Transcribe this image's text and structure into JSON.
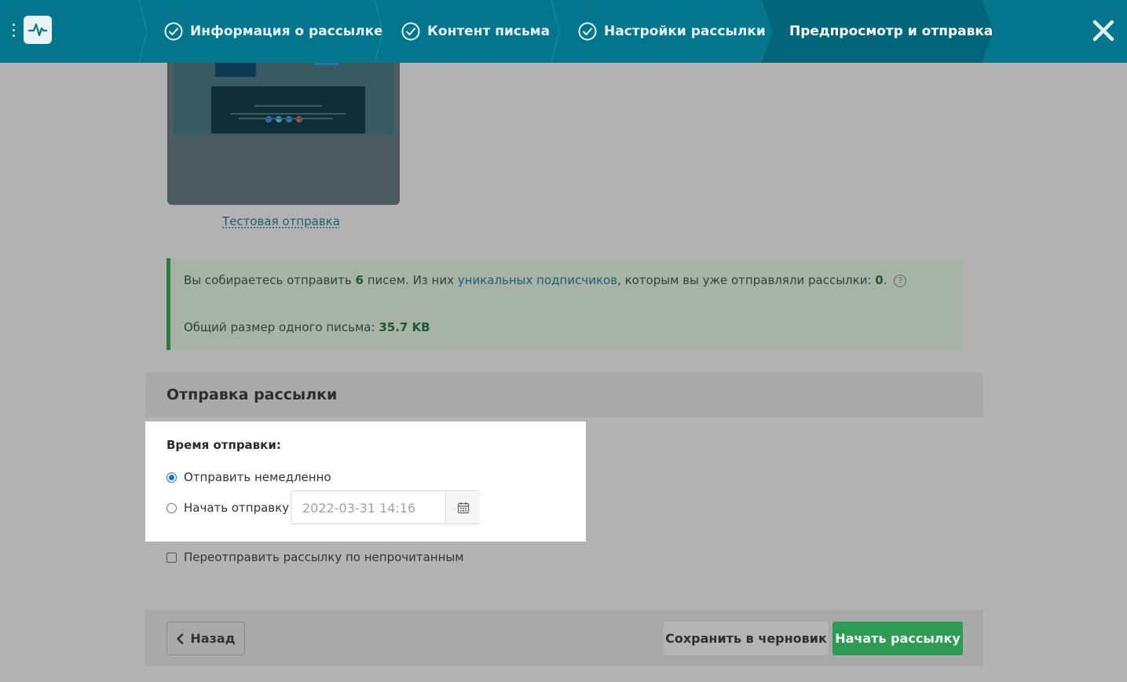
{
  "wizard": {
    "steps": [
      {
        "label": "Информация о рассылке",
        "done": true
      },
      {
        "label": "Контент письма",
        "done": true
      },
      {
        "label": "Настройки рассылки",
        "done": true
      },
      {
        "label": "Предпросмотр и отправка",
        "done": false,
        "active": true
      }
    ]
  },
  "preview": {
    "test_send_link": "Тестовая отправка"
  },
  "summary": {
    "line1_prefix": "Вы собираетесь отправить",
    "count": "6",
    "line1_mid": "писем.  Из них",
    "unique_link": "уникальных подписчиков",
    "line1_suffix": ", которым вы уже отправляли рассылки:",
    "already_sent": "0",
    "period": ".",
    "help": "?",
    "size_label": "Общий размер одного письма:",
    "size_value": "35.7 KB"
  },
  "sending": {
    "section_title": "Отправка рассылки",
    "time_label": "Время отправки:",
    "option_now": "Отправить немедленно",
    "option_schedule": "Начать отправку",
    "schedule_value": "2022-03-31 14:16",
    "selected": "now",
    "resend_label": "Переотправить рассылку по непрочитанным",
    "resend_checked": false
  },
  "footer": {
    "back_label": "Назад",
    "draft_label": "Сохранить в черновик",
    "start_label": "Начать рассылку"
  },
  "colors": {
    "topbar": "#03768d",
    "active_step": "#02657a",
    "primary_green": "#2e9b55",
    "radio_blue": "#1a73c9"
  }
}
